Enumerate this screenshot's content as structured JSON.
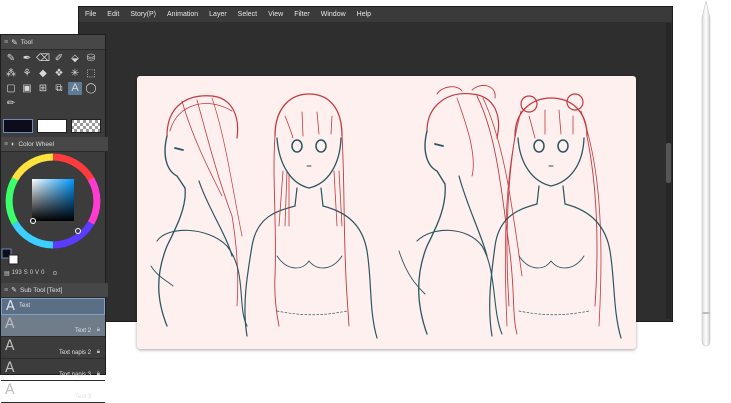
{
  "menubar": {
    "items": [
      "File",
      "Edit",
      "Story(P)",
      "Animation",
      "Layer",
      "Select",
      "View",
      "Filter",
      "Window",
      "Help"
    ]
  },
  "tool_panel": {
    "title": "Tool",
    "tools": [
      "pencil-icon",
      "pen-icon",
      "eraser-icon",
      "marker-icon",
      "fill-icon",
      "bucket-icon",
      "airbrush-icon",
      "brush-icon",
      "blend-icon",
      "decoration-icon",
      "sparkle-icon",
      "select-icon",
      "frame-icon",
      "gradient-icon",
      "layout-icon",
      "transform-icon",
      "text-icon",
      "balloon-icon",
      "ruler-icon"
    ],
    "active_tool": "text-icon"
  },
  "color_wheel": {
    "title": "Color Wheel",
    "values": [
      "193",
      "0",
      "0"
    ],
    "main_color": "#0c0c1c",
    "sub_color": "#ffffff"
  },
  "sub_tool": {
    "title": "Sub Tool [Text]",
    "items": [
      {
        "label": "Text",
        "state": "active"
      },
      {
        "label": "Text 2",
        "state": "selected"
      },
      {
        "label": "Text napis 2",
        "state": "normal"
      },
      {
        "label": "Text napis 3",
        "state": "normal"
      },
      {
        "label": "Text 3",
        "state": "normal"
      }
    ]
  },
  "colors": {
    "sketch_red": "#c4393f",
    "sketch_teal": "#2c5561",
    "canvas_bg": "#fdf0ef",
    "accent": "#5f7c96"
  }
}
